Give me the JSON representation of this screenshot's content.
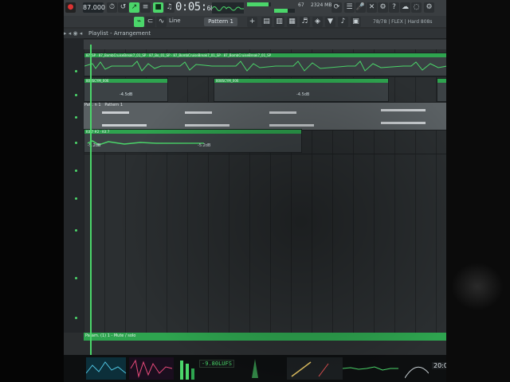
{
  "toolbar": {
    "bpm": "87.000",
    "time_main": "0:05",
    "time_frac": "68",
    "mem": "2324 MB",
    "cpu": "67",
    "pattern": "Pattern 1",
    "snap": "Line",
    "hint": "78/78 | FLEX | Hard 808s"
  },
  "playlist": {
    "title": "Playlist - Arrangement",
    "tracks": [
      {
        "clip": "87_SP",
        "clip2": "87_BombCruiseBreak7_01_SP",
        "clip3": "87_Bo_01_SP",
        "clip4": "87_BombCruiseBreak7_01_SP",
        "clip5": "87_BombCruiseBreak7_01_SP"
      },
      {
        "clip": "808SCYM_006",
        "clip2": "808SCYM_006",
        "gain1": "-4.5dB",
        "gain2": "-4.5dB"
      },
      {
        "clip": "Pat.. n 1",
        "clip2": "Pattern 1"
      },
      {
        "clip": "Kit 7 #2",
        "clip2": "Kit 7",
        "gain1": "-5.2dB",
        "gain2": "-5.2dB"
      }
    ],
    "automation": "Param. (1) 1 - Mute / solo"
  },
  "bottom": {
    "lufs": "-9.80LUFS",
    "clock": "20:0"
  },
  "colors": {
    "accent": "#4bd66a",
    "clip_header": "#2ea44f",
    "background": "#2b2e30"
  }
}
